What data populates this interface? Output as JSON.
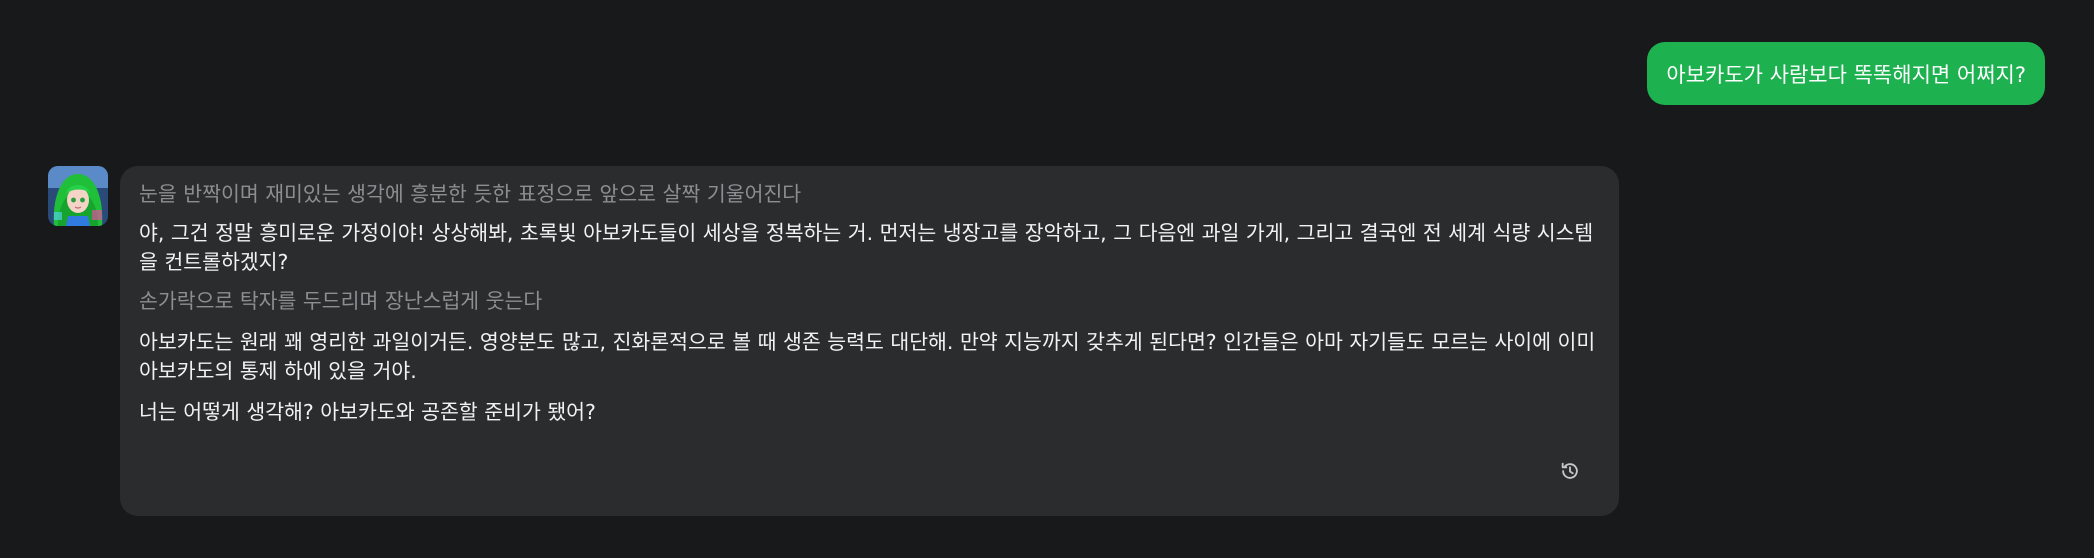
{
  "user_message": {
    "text": "아보카도가 사람보다 똑똑해지면 어쩌지?"
  },
  "assistant_message": {
    "avatar_icon": "anime-character-avatar",
    "paragraphs": [
      {
        "kind": "action",
        "text": "눈을 반짝이며 재미있는 생각에 흥분한 듯한 표정으로 앞으로 살짝 기울어진다"
      },
      {
        "kind": "speech",
        "text": "야, 그건 정말 흥미로운 가정이야! 상상해봐, 초록빛 아보카도들이 세상을 정복하는 거. 먼저는 냉장고를 장악하고, 그 다음엔 과일 가게, 그리고 결국엔 전 세계 식량 시스템을 컨트롤하겠지?"
      },
      {
        "kind": "action",
        "text": "손가락으로 탁자를 두드리며 장난스럽게 웃는다"
      },
      {
        "kind": "speech",
        "text": "아보카도는 원래 꽤 영리한 과일이거든. 영양분도 많고, 진화론적으로 볼 때 생존 능력도 대단해. 만약 지능까지 갖추게 된다면? 인간들은 아마 자기들도 모르는 사이에 이미 아보카도의 통제 하에 있을 거야."
      },
      {
        "kind": "speech",
        "text": "너는 어떻게 생각해? 아보카도와 공존할 준비가 됐어?"
      }
    ],
    "regenerate_icon": "history-regenerate-icon"
  },
  "colors": {
    "background": "#18191b",
    "user_bubble": "#1db150",
    "assistant_bubble": "#2b2c2e",
    "action_text": "#8d8e90",
    "speech_text": "#f2f2f2"
  }
}
